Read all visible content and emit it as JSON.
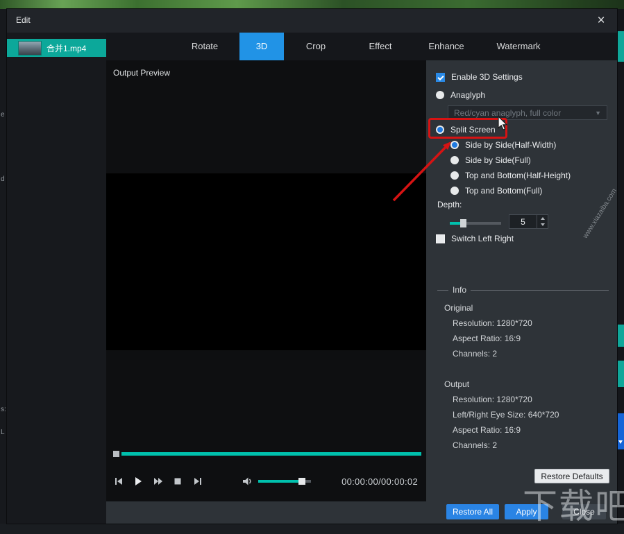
{
  "window": {
    "title": "Edit",
    "close_glyph": "×"
  },
  "file_panel": {
    "selected_file": "合并1.mp4"
  },
  "tabs": [
    {
      "label": "Rotate",
      "active": false
    },
    {
      "label": "3D",
      "active": true
    },
    {
      "label": "Crop",
      "active": false
    },
    {
      "label": "Effect",
      "active": false
    },
    {
      "label": "Enhance",
      "active": false
    },
    {
      "label": "Watermark",
      "active": false
    }
  ],
  "preview": {
    "title": "Output Preview",
    "time_display": "00:00:00/00:00:02"
  },
  "settings": {
    "enable_3d": {
      "label": "Enable 3D Settings",
      "checked": true
    },
    "anaglyph": {
      "label": "Anaglyph",
      "selected": false
    },
    "anaglyph_mode": {
      "value": "Red/cyan anaglyph, full color",
      "caret": "▼",
      "enabled": false
    },
    "split_screen": {
      "label": "Split Screen",
      "selected": true
    },
    "split_modes": [
      {
        "label": "Side by Side(Half-Width)",
        "selected": true
      },
      {
        "label": "Side by Side(Full)",
        "selected": false
      },
      {
        "label": "Top and Bottom(Half-Height)",
        "selected": false
      },
      {
        "label": "Top and Bottom(Full)",
        "selected": false
      }
    ],
    "depth": {
      "label": "Depth:",
      "value": "5"
    },
    "switch_left_right": {
      "label": "Switch Left Right",
      "checked": false
    }
  },
  "info": {
    "title": "Info",
    "original": {
      "title": "Original",
      "rows": [
        "Resolution: 1280*720",
        "Aspect Ratio: 16:9",
        "Channels: 2"
      ]
    },
    "output": {
      "title": "Output",
      "rows": [
        "Resolution: 1280*720",
        "Left/Right Eye Size: 640*720",
        "Aspect Ratio: 16:9",
        "Channels: 2"
      ]
    },
    "restore_defaults_label": "Restore Defaults"
  },
  "footer": {
    "restore_all_label": "Restore All",
    "apply_label": "Apply",
    "close_label": "Close"
  },
  "watermarks": {
    "large": "下载吧",
    "small": "www.xiazaiba.com"
  },
  "background_fragments": [
    "e",
    "d",
    "s:",
    "L"
  ],
  "annotations": {
    "highlight_color": "#d61313",
    "arrow_color": "#d61313"
  },
  "colors": {
    "accent_blue": "#2a8ae6",
    "accent_teal": "#0ca89a",
    "progress_teal": "#00c0ad",
    "dialog_bg": "#2e3338",
    "panel_dark": "#17191d",
    "preview_black": "#0e0f11"
  }
}
